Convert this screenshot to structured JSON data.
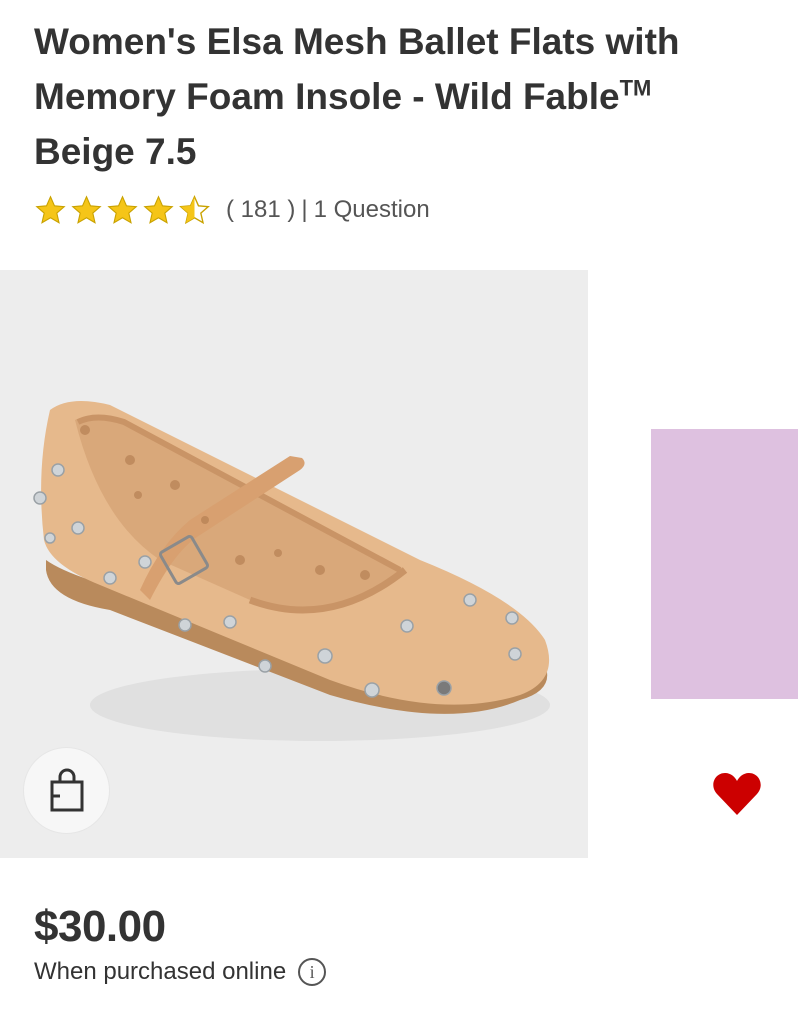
{
  "product": {
    "title": "Women's Elsa Mesh Ballet Flats with Memory Foam Insole - Wild Fable",
    "trademark": "TM",
    "variant": "Beige 7.5",
    "rating_value": 4.5,
    "rating_max": 5,
    "review_count_text": "( 181 )",
    "separator": "|",
    "questions_text": "1 Question",
    "price": "$30.00",
    "price_note": "When purchased online",
    "info_symbol": "i"
  },
  "icons": {
    "star": "star-icon",
    "half_star": "star-half-icon",
    "shopping_bag": "shopping-bag-icon",
    "favorite": "heart-icon",
    "info": "info-icon"
  },
  "colors": {
    "star": "#f5c518",
    "star_outline": "#c9a200",
    "heart": "#cc0000",
    "image_bg": "#ededed",
    "next_image": "#dec1e0",
    "text": "#333333"
  }
}
